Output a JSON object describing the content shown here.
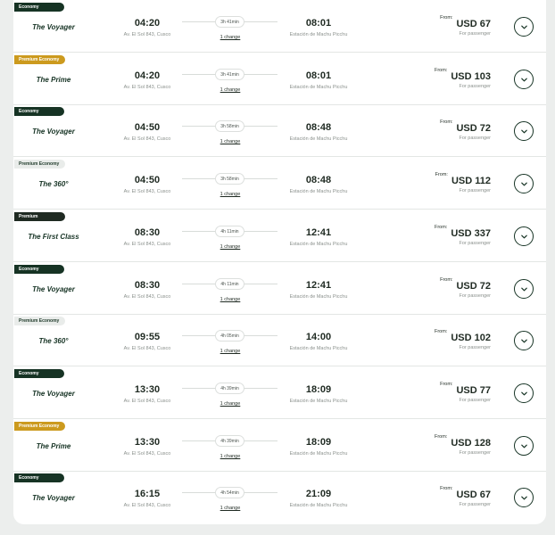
{
  "results": [
    {
      "fare_class": "Economy",
      "badge_style": "economy",
      "train": "The Voyager",
      "departure_time": "04:20",
      "departure_place": "Av. El Sol 843, Cusco",
      "duration": "3h 41min",
      "changes": "1 change",
      "arrival_time": "08:01",
      "arrival_place": "Estación de Machu Picchu",
      "from_label": "From:",
      "price": "USD 67",
      "per_label": "For passenger"
    },
    {
      "fare_class": "Premium Economy",
      "badge_style": "premium-economy",
      "train": "The Prime",
      "departure_time": "04:20",
      "departure_place": "Av. El Sol 843, Cusco",
      "duration": "3h 41min",
      "changes": "1 change",
      "arrival_time": "08:01",
      "arrival_place": "Estación de Machu Picchu",
      "from_label": "From:",
      "price": "USD 103",
      "per_label": "For passenger"
    },
    {
      "fare_class": "Economy",
      "badge_style": "economy",
      "train": "The Voyager",
      "departure_time": "04:50",
      "departure_place": "Av. El Sol 843, Cusco",
      "duration": "3h 58min",
      "changes": "1 change",
      "arrival_time": "08:48",
      "arrival_place": "Estación de Machu Picchu",
      "from_label": "From:",
      "price": "USD 72",
      "per_label": "For passenger"
    },
    {
      "fare_class": "Premium Economy",
      "badge_style": "premium-economy-light",
      "train": "The 360°",
      "departure_time": "04:50",
      "departure_place": "Av. El Sol 843, Cusco",
      "duration": "3h 58min",
      "changes": "1 change",
      "arrival_time": "08:48",
      "arrival_place": "Estación de Machu Picchu",
      "from_label": "From:",
      "price": "USD 112",
      "per_label": "For passenger"
    },
    {
      "fare_class": "Premium",
      "badge_style": "premium",
      "train": "The First Class",
      "departure_time": "08:30",
      "departure_place": "Av. El Sol 843, Cusco",
      "duration": "4h 11min",
      "changes": "1 change",
      "arrival_time": "12:41",
      "arrival_place": "Estación de Machu Picchu",
      "from_label": "From:",
      "price": "USD 337",
      "per_label": "For passenger"
    },
    {
      "fare_class": "Economy",
      "badge_style": "economy",
      "train": "The Voyager",
      "departure_time": "08:30",
      "departure_place": "Av. El Sol 843, Cusco",
      "duration": "4h 11min",
      "changes": "1 change",
      "arrival_time": "12:41",
      "arrival_place": "Estación de Machu Picchu",
      "from_label": "From:",
      "price": "USD 72",
      "per_label": "For passenger"
    },
    {
      "fare_class": "Premium Economy",
      "badge_style": "premium-economy-light",
      "train": "The 360°",
      "departure_time": "09:55",
      "departure_place": "Av. El Sol 843, Cusco",
      "duration": "4h 05min",
      "changes": "1 change",
      "arrival_time": "14:00",
      "arrival_place": "Estación de Machu Picchu",
      "from_label": "From:",
      "price": "USD 102",
      "per_label": "For passenger"
    },
    {
      "fare_class": "Economy",
      "badge_style": "economy",
      "train": "The Voyager",
      "departure_time": "13:30",
      "departure_place": "Av. El Sol 843, Cusco",
      "duration": "4h 39min",
      "changes": "1 change",
      "arrival_time": "18:09",
      "arrival_place": "Estación de Machu Picchu",
      "from_label": "From:",
      "price": "USD 77",
      "per_label": "For passenger"
    },
    {
      "fare_class": "Premium Economy",
      "badge_style": "premium-economy",
      "train": "The Prime",
      "departure_time": "13:30",
      "departure_place": "Av. El Sol 843, Cusco",
      "duration": "4h 39min",
      "changes": "1 change",
      "arrival_time": "18:09",
      "arrival_place": "Estación de Machu Picchu",
      "from_label": "From:",
      "price": "USD 128",
      "per_label": "For passenger"
    },
    {
      "fare_class": "Economy",
      "badge_style": "economy",
      "train": "The Voyager",
      "departure_time": "16:15",
      "departure_place": "Av. El Sol 843, Cusco",
      "duration": "4h 54min",
      "changes": "1 change",
      "arrival_time": "21:09",
      "arrival_place": "Estación de Machu Picchu",
      "from_label": "From:",
      "price": "USD 67",
      "per_label": "For passenger"
    }
  ],
  "colors": {
    "economy": "#163324",
    "premium_economy": "#cc9a1e",
    "premium": "#1f2a22",
    "background": "#eceeed"
  },
  "icons": {
    "expand": "chevron-down-icon"
  }
}
